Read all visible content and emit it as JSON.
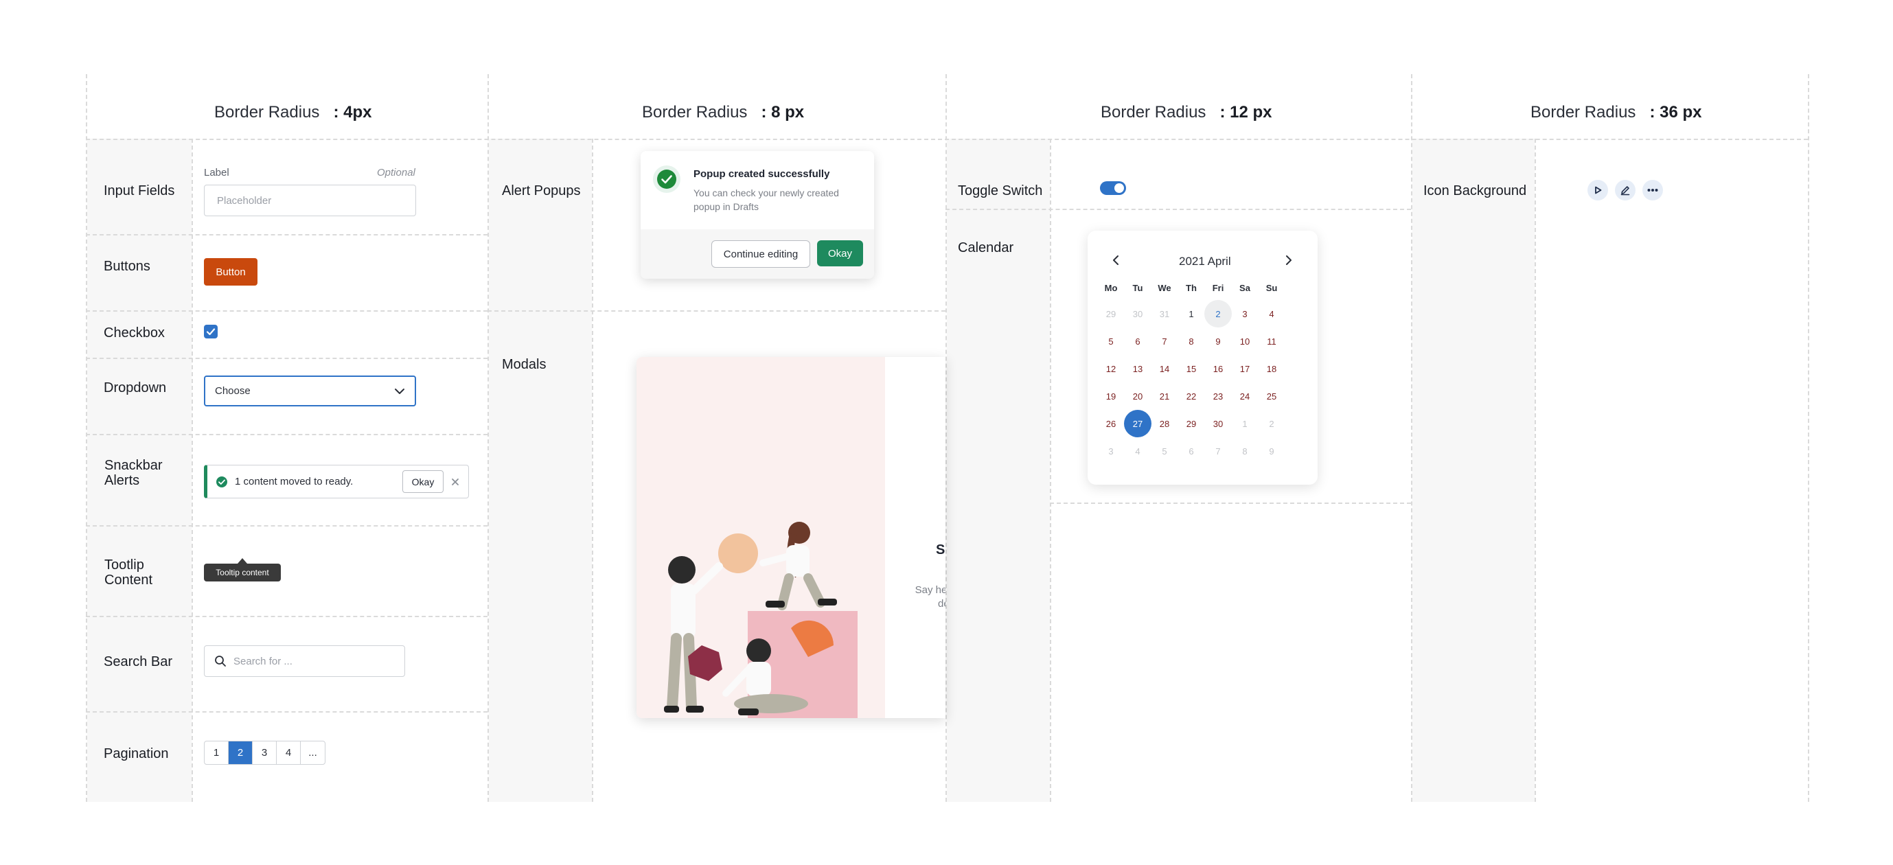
{
  "columns": [
    {
      "prefix": "Border Radius",
      "value": ": 4px"
    },
    {
      "prefix": "Border Radius",
      "value": ": 8 px"
    },
    {
      "prefix": "Border Radius",
      "value": ": 12 px"
    },
    {
      "prefix": "Border Radius",
      "value": ": 36 px"
    }
  ],
  "col1": {
    "input": {
      "row_label": "Input Fields",
      "label": "Label",
      "optional": "Optional",
      "placeholder": "Placeholder"
    },
    "buttons": {
      "row_label": "Buttons",
      "button_label": "Button"
    },
    "checkbox": {
      "row_label": "Checkbox",
      "checked": true
    },
    "dropdown": {
      "row_label": "Dropdown",
      "value": "Choose"
    },
    "snackbar": {
      "row_label_1": "Snackbar",
      "row_label_2": "Alerts",
      "message": "1 content moved to ready.",
      "action": "Okay"
    },
    "tooltip": {
      "row_label_1": "Tootlip",
      "row_label_2": "Content",
      "text": "Tooltip content"
    },
    "search": {
      "row_label": "Search Bar",
      "placeholder": "Search for ..."
    },
    "pagination": {
      "row_label": "Pagination",
      "pages": [
        "1",
        "2",
        "3",
        "4",
        "..."
      ],
      "active": "2"
    }
  },
  "col2": {
    "alert": {
      "row_label": "Alert Popups",
      "title": "Popup created successfully",
      "body_1": "You can check your newly created",
      "body_2": "popup in Drafts",
      "secondary": "Continue editing",
      "primary": "Okay"
    },
    "modal": {
      "row_label": "Modals",
      "heading_partial": "Sn",
      "body_partial_1": "Say hel",
      "body_partial_2": "de"
    }
  },
  "col3": {
    "toggle": {
      "row_label": "Toggle Switch",
      "on": true
    },
    "calendar": {
      "row_label": "Calendar",
      "title": "2021 April",
      "weekdays": [
        "Mo",
        "Tu",
        "We",
        "Th",
        "Fri",
        "Sa",
        "Su"
      ],
      "weeks": [
        [
          "29",
          "30",
          "31",
          "1",
          "2",
          "3",
          "4"
        ],
        [
          "5",
          "6",
          "7",
          "8",
          "9",
          "10",
          "11"
        ],
        [
          "12",
          "13",
          "14",
          "15",
          "16",
          "17",
          "18"
        ],
        [
          "19",
          "20",
          "21",
          "22",
          "23",
          "24",
          "25"
        ],
        [
          "26",
          "27",
          "28",
          "29",
          "30",
          "1",
          "2"
        ],
        [
          "3",
          "4",
          "5",
          "6",
          "7",
          "8",
          "9"
        ]
      ],
      "selected": "27"
    }
  },
  "col4": {
    "icons": {
      "row_label": "Icon Background",
      "items": [
        "play-icon",
        "edit-icon",
        "more-icon"
      ]
    }
  },
  "colors": {
    "accent": "#2f73c7",
    "orange_button": "#c9490d",
    "success": "#1e8a5e"
  }
}
